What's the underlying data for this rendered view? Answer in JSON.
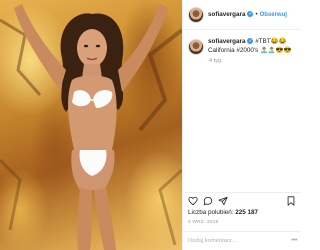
{
  "post": {
    "username": "sofiavergara",
    "follow_label": "Obserwuj",
    "separator": "•",
    "caption_username": "sofiavergara",
    "caption_text": "#TBT😂😂 California #2000's 🏝️🏝️😎😎",
    "caption_time": "4 tyg.",
    "likes_label": "Liczba polubień:",
    "likes_count": "225 187",
    "date": "4 WRZ. 2018",
    "comment_placeholder": "Dodaj komentarz...",
    "more_label": "•••"
  },
  "icons": {
    "verified": "verified-badge-icon",
    "like": "heart-icon",
    "comment": "comment-icon",
    "share": "share-icon",
    "save": "bookmark-icon"
  },
  "colors": {
    "accent": "#3897f0",
    "text": "#262626",
    "muted": "#999999",
    "border": "#efefef"
  }
}
